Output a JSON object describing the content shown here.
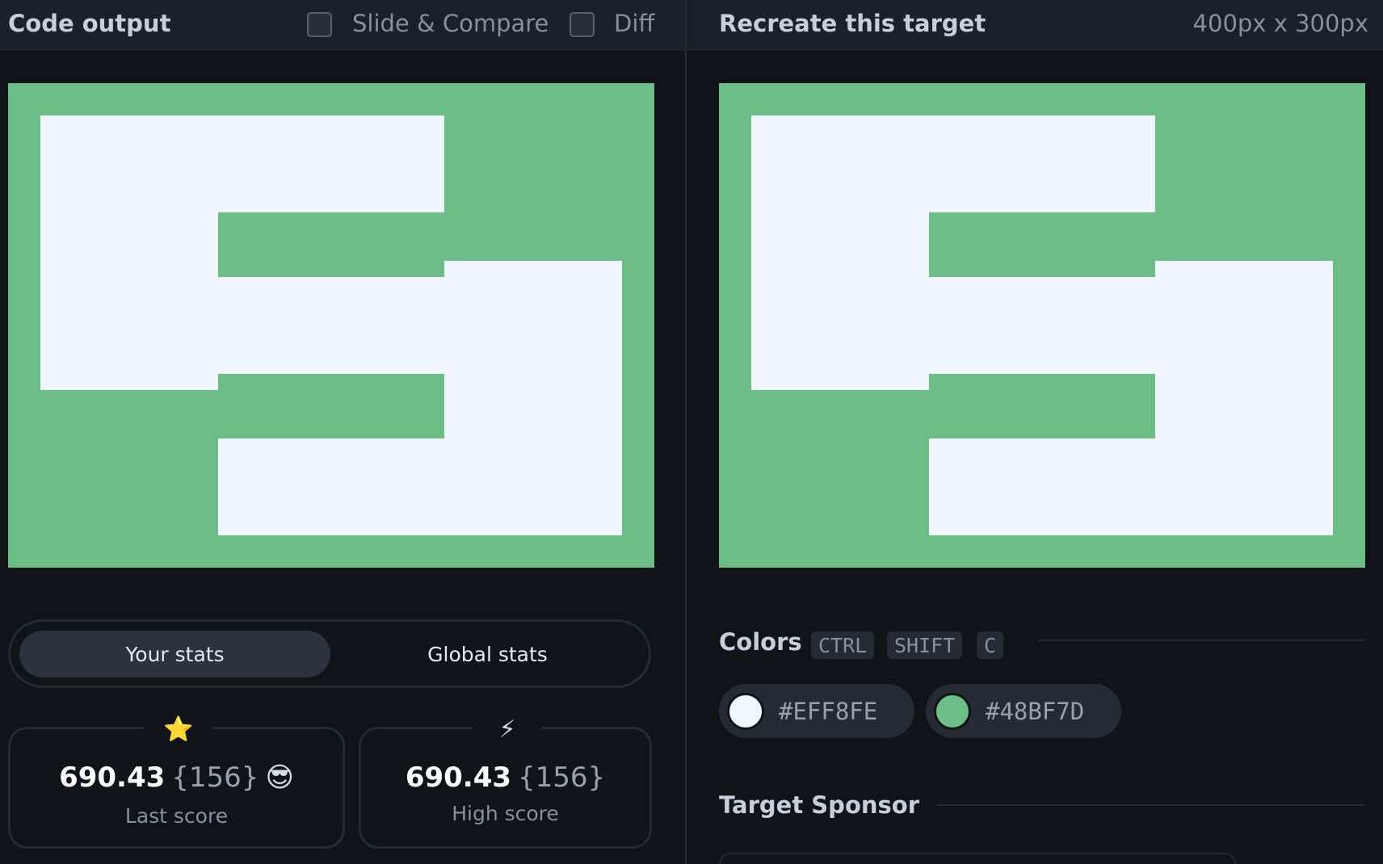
{
  "left_panel": {
    "title": "Code output",
    "slide_compare_label": "Slide & Compare",
    "diff_label": "Diff"
  },
  "right_panel": {
    "title": "Recreate this target",
    "dimensions": "400px x 300px"
  },
  "stats": {
    "tabs": [
      "Your stats",
      "Global stats"
    ],
    "active_tab": "Your stats",
    "last": {
      "icon": "star-icon",
      "glyph": "⭐",
      "score": "690.43",
      "count": "{156}",
      "emoji": "😎",
      "label": "Last score"
    },
    "high": {
      "icon": "lightning-icon",
      "glyph": "⚡",
      "score": "690.43",
      "count": "{156}",
      "label": "High score"
    }
  },
  "colors": {
    "title": "Colors",
    "shortcut": [
      "CTRL",
      "SHIFT",
      "C"
    ],
    "swatches": [
      {
        "hex": "#EFF8FE"
      },
      {
        "hex": "#48BF7D"
      }
    ]
  },
  "sponsor": {
    "title": "Target Sponsor"
  }
}
